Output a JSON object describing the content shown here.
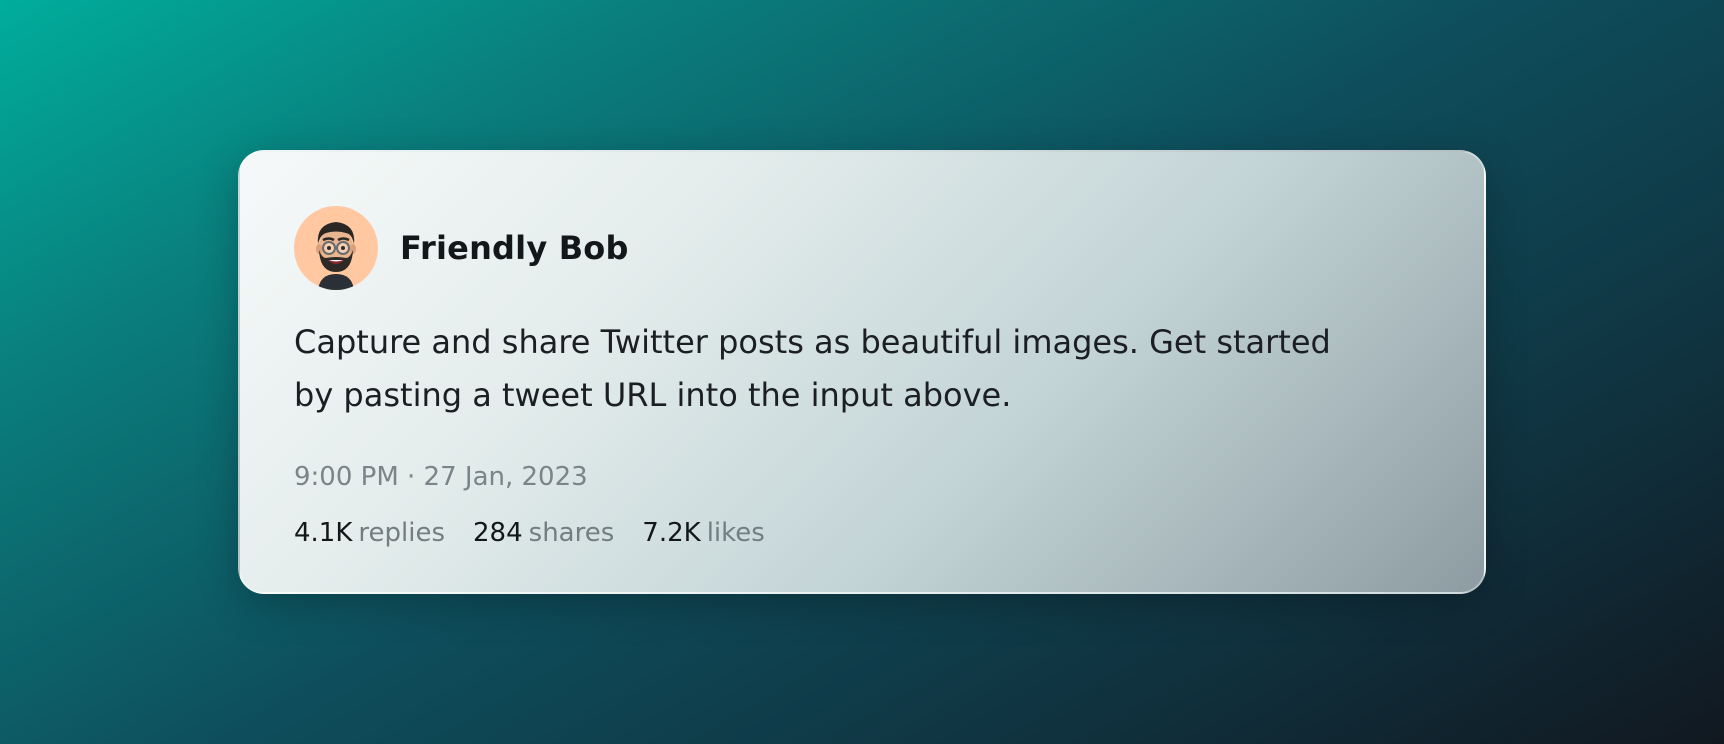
{
  "post": {
    "author_name": "Friendly Bob",
    "text": "Capture and share Twitter posts as beautiful images. Get started by pasting a tweet URL into the input above.",
    "timestamp": "9:00 PM · 27 Jan, 2023",
    "stats": [
      {
        "count": "4.1K",
        "label": "replies"
      },
      {
        "count": "284",
        "label": "shares"
      },
      {
        "count": "7.2K",
        "label": "likes"
      }
    ]
  },
  "avatar_icon": "memoji-avatar-icon",
  "colors": {
    "avatar_bg": "#ffc8a0",
    "text_primary": "#14171a",
    "text_muted": "#7a8489"
  }
}
